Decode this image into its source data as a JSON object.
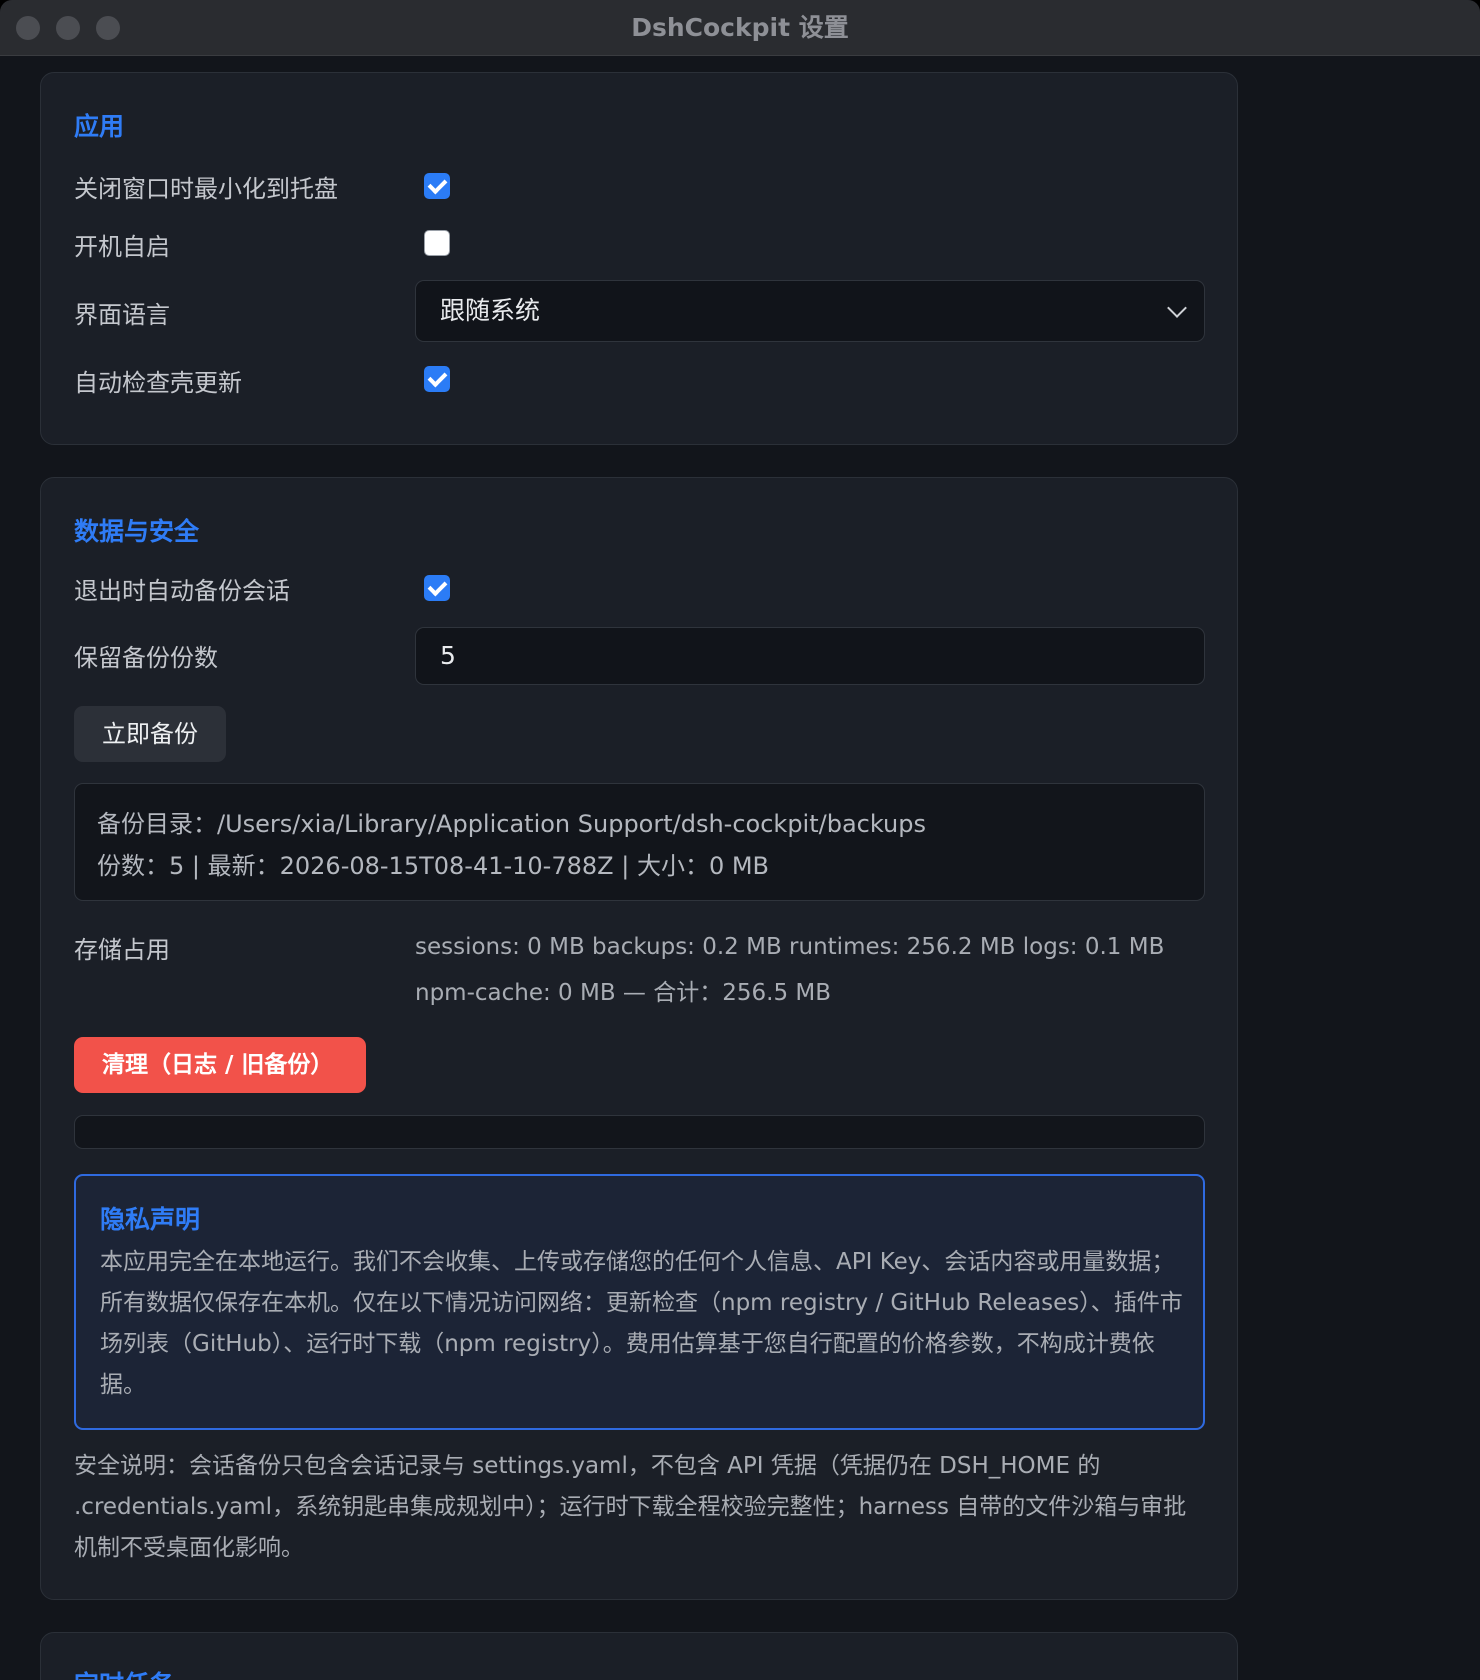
{
  "window": {
    "title": "DshCockpit 设置"
  },
  "app": {
    "title": "应用",
    "minimize_label": "关闭窗口时最小化到托盘",
    "minimize_checked": true,
    "autostart_label": "开机自启",
    "autostart_checked": false,
    "language_label": "界面语言",
    "language_value": "跟随系统",
    "autoupdate_label": "自动检查壳更新",
    "autoupdate_checked": true
  },
  "data_security": {
    "title": "数据与安全",
    "autobackup_label": "退出时自动备份会话",
    "autobackup_checked": true,
    "keep_label": "保留备份份数",
    "keep_value": "5",
    "backup_button": "立即备份",
    "backup_dir_line": "备份目录：/Users/xia/Library/Application Support/dsh-cockpit/backups",
    "backup_stats_line": "份数：5 | 最新：2026-08-15T08-41-10-788Z | 大小：0 MB",
    "storage_label": "存储占用",
    "storage_line1": "sessions: 0 MB backups: 0.2 MB runtimes: 256.2 MB logs: 0.1 MB",
    "storage_line2": "npm-cache: 0 MB — 合计：256.5 MB",
    "cleanup_button": "清理（日志 / 旧备份）",
    "privacy_title": "隐私声明",
    "privacy_text": "本应用完全在本地运行。我们不会收集、上传或存储您的任何个人信息、API Key、会话内容或用量数据；所有数据仅保存在本机。仅在以下情况访问网络：更新检查（npm registry / GitHub Releases）、插件市场列表（GitHub）、运行时下载（npm registry）。费用估算基于您自行配置的价格参数，不构成计费依据。",
    "security_note": "安全说明：会话备份只包含会话记录与 settings.yaml，不包含 API 凭据（凭据仍在 DSH_HOME 的 .credentials.yaml，系统钥匙串集成规划中）；运行时下载全程校验完整性；harness 自带的文件沙箱与审批机制不受桌面化影响。"
  },
  "scheduled": {
    "title": "定时任务"
  },
  "colors": {
    "accent": "#2f7cf6",
    "danger": "#f2524a",
    "checkbox": "#2b7cf6"
  }
}
